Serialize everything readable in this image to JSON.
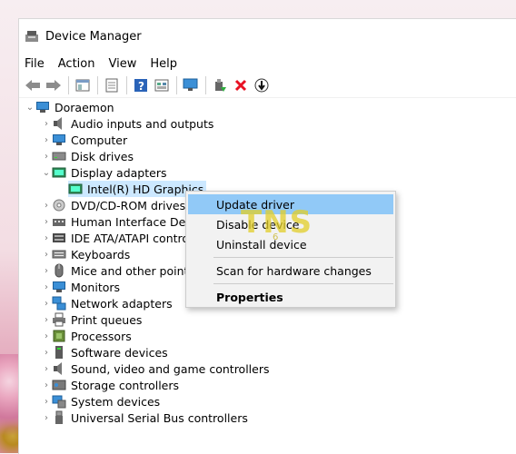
{
  "window": {
    "title": "Device Manager"
  },
  "menu": [
    "File",
    "Action",
    "View",
    "Help"
  ],
  "tree": {
    "root": "Doraemon",
    "items": [
      {
        "label": "Audio inputs and outputs",
        "icon": "speaker-icon",
        "expanded": false
      },
      {
        "label": "Computer",
        "icon": "computer-icon",
        "expanded": false
      },
      {
        "label": "Disk drives",
        "icon": "disk-drive-icon",
        "expanded": false
      },
      {
        "label": "Display adapters",
        "icon": "display-adapter-icon",
        "expanded": true
      },
      {
        "label": "Intel(R) HD Graphics",
        "icon": "display-adapter-icon",
        "child": true,
        "selected": true
      },
      {
        "label": "DVD/CD-ROM drives",
        "icon": "dvd-icon",
        "expanded": false
      },
      {
        "label": "Human Interface Devic",
        "icon": "hid-icon",
        "expanded": false
      },
      {
        "label": "IDE ATA/ATAPI controlle",
        "icon": "ide-icon",
        "expanded": false
      },
      {
        "label": "Keyboards",
        "icon": "keyboard-icon",
        "expanded": false
      },
      {
        "label": "Mice and other pointin",
        "icon": "mouse-icon",
        "expanded": false
      },
      {
        "label": "Monitors",
        "icon": "monitor-icon",
        "expanded": false
      },
      {
        "label": "Network adapters",
        "icon": "network-icon",
        "expanded": false
      },
      {
        "label": "Print queues",
        "icon": "printer-icon",
        "expanded": false
      },
      {
        "label": "Processors",
        "icon": "processor-icon",
        "expanded": false
      },
      {
        "label": "Software devices",
        "icon": "software-device-icon",
        "expanded": false
      },
      {
        "label": "Sound, video and game controllers",
        "icon": "sound-icon",
        "expanded": false
      },
      {
        "label": "Storage controllers",
        "icon": "storage-icon",
        "expanded": false
      },
      {
        "label": "System devices",
        "icon": "system-icon",
        "expanded": false
      },
      {
        "label": "Universal Serial Bus controllers",
        "icon": "usb-icon",
        "expanded": false
      }
    ]
  },
  "context_menu": {
    "update": "Update driver",
    "disable": "Disable device",
    "uninstall": "Uninstall device",
    "scan": "Scan for hardware changes",
    "properties": "Properties"
  },
  "watermark": {
    "text": "TNS",
    "sub": "6"
  },
  "colors": {
    "selection": "#cce8ff",
    "menu_highlight": "#91c9f7",
    "accent": "#3b8fd6",
    "delete": "#e81123"
  }
}
